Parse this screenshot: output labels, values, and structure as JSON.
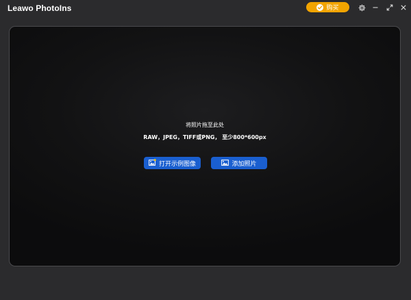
{
  "app": {
    "title": "Leawo PhotoIns"
  },
  "titlebar": {
    "buy_label": "购买",
    "controls": [
      "gear-icon",
      "minimize-icon",
      "maximize-icon",
      "close-icon"
    ]
  },
  "drop_area": {
    "title": "将照片拖至此处",
    "formats": "RAW，JPEG，TIFF或PNG， 至少800*600px",
    "open_sample_label": "打开示例图像",
    "add_photo_label": "添加照片"
  },
  "colors": {
    "background": "#2b2b2d",
    "panel": "#121213",
    "buy_button": "#f2a400",
    "action_button": "#1a5fd0"
  }
}
